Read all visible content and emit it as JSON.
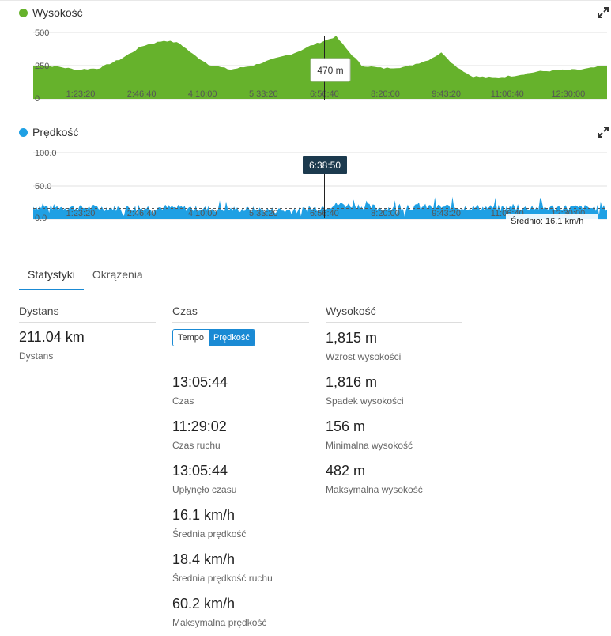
{
  "elevation_chart": {
    "title": "Wysokość",
    "color": "#66b22c",
    "tooltip": "470 m",
    "y_ticks": [
      "500",
      "250",
      "0"
    ],
    "x_ticks": [
      "1:23:20",
      "2:46:40",
      "4:10:00",
      "5:33:20",
      "6:56:40",
      "8:20:00",
      "9:43:20",
      "11:06:40",
      "12:30:00"
    ]
  },
  "speed_chart": {
    "title": "Prędkość",
    "color": "#1fa0e4",
    "tooltip": "6:38:50",
    "y_ticks": [
      "100.0",
      "50.0",
      "0.0"
    ],
    "x_ticks": [
      "1:23:20",
      "2:46:40",
      "4:10:00",
      "5:33:20",
      "6:56:40",
      "8:20:00",
      "9:43:20",
      "11:06:40",
      "12:30:00"
    ],
    "average_label": "Średnio: 16.1 km/h"
  },
  "chart_data": [
    {
      "type": "area",
      "title": "Wysokość",
      "x": [
        "0:00:00",
        "0:30:00",
        "1:00:00",
        "1:30:00",
        "2:00:00",
        "2:30:00",
        "3:00:00",
        "3:20:00",
        "3:40:00",
        "4:00:00",
        "4:30:00",
        "5:00:00",
        "5:30:00",
        "6:00:00",
        "6:20:00",
        "6:40:00",
        "6:55:00",
        "7:10:00",
        "7:30:00",
        "8:00:00",
        "8:30:00",
        "9:00:00",
        "9:20:00",
        "9:35:00",
        "10:00:00",
        "10:30:00",
        "11:00:00",
        "11:30:00",
        "12:00:00",
        "12:30:00",
        "13:05:44"
      ],
      "y": [
        250,
        245,
        220,
        230,
        300,
        400,
        440,
        420,
        330,
        260,
        220,
        250,
        300,
        350,
        400,
        440,
        470,
        370,
        250,
        230,
        240,
        290,
        350,
        260,
        170,
        160,
        175,
        205,
        215,
        220,
        250
      ],
      "ylim": [
        0,
        500
      ],
      "xlabel": "",
      "ylabel": ""
    },
    {
      "type": "area",
      "title": "Prędkość",
      "x": [
        "0:00:00",
        "1:00:00",
        "2:00:00",
        "3:00:00",
        "4:00:00",
        "5:00:00",
        "6:00:00",
        "6:38:50",
        "7:00:00",
        "8:00:00",
        "9:00:00",
        "10:00:00",
        "11:00:00",
        "12:00:00",
        "13:05:44"
      ],
      "y": [
        18,
        17,
        16,
        17,
        15,
        14,
        12,
        18,
        22,
        16,
        18,
        17,
        16,
        17,
        16
      ],
      "average": 16.1,
      "ylim": [
        0,
        100
      ],
      "xlabel": "",
      "ylabel": ""
    }
  ],
  "tabs": [
    "Statystyki",
    "Okrążenia"
  ],
  "distance": {
    "heading": "Dystans",
    "value": "211.04 km",
    "label": "Dystans"
  },
  "time": {
    "heading": "Czas",
    "toggle": [
      "Tempo",
      "Prędkość"
    ],
    "stats": [
      {
        "value": "13:05:44",
        "label": "Czas"
      },
      {
        "value": "11:29:02",
        "label": "Czas ruchu"
      },
      {
        "value": "13:05:44",
        "label": "Upłynęło czasu"
      },
      {
        "value": "16.1 km/h",
        "label": "Średnia prędkość"
      },
      {
        "value": "18.4 km/h",
        "label": "Średnia prędkość ruchu"
      },
      {
        "value": "60.2 km/h",
        "label": "Maksymalna prędkość"
      }
    ]
  },
  "elevation": {
    "heading": "Wysokość",
    "stats": [
      {
        "value": "1,815 m",
        "label": "Wzrost wysokości"
      },
      {
        "value": "1,816 m",
        "label": "Spadek wysokości"
      },
      {
        "value": "156 m",
        "label": "Minimalna wysokość"
      },
      {
        "value": "482 m",
        "label": "Maksymalna wysokość"
      }
    ]
  }
}
